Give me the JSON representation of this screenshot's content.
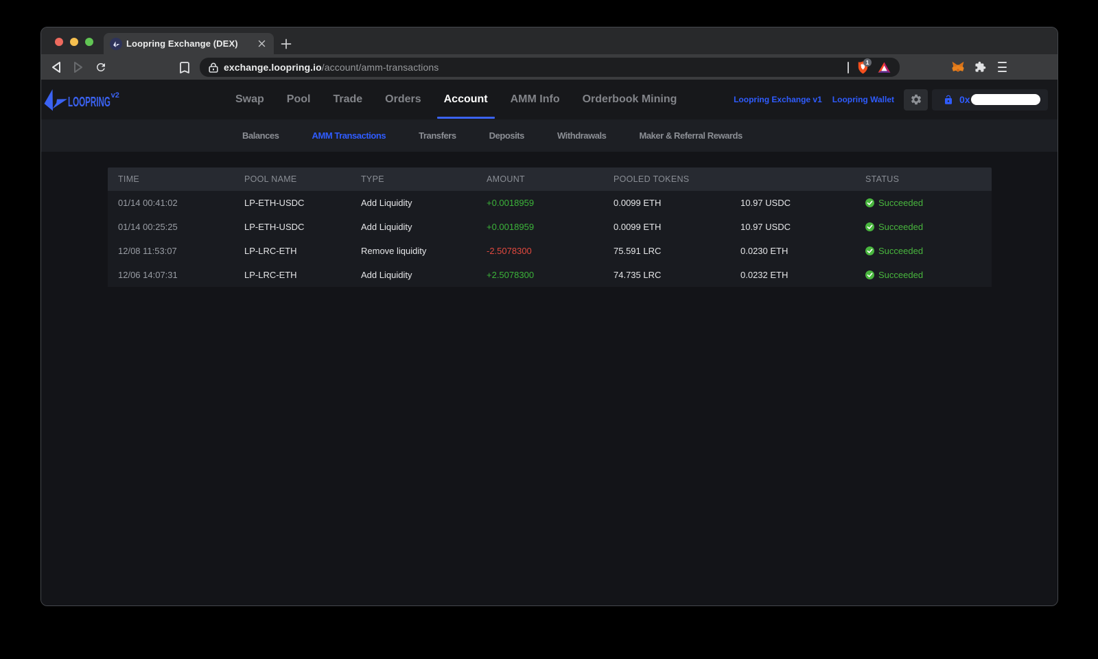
{
  "browser": {
    "tab_title": "Loopring Exchange (DEX)",
    "url_domain": "exchange.loopring.io",
    "url_path": "/account/amm-transactions",
    "shield_badge": "1"
  },
  "header": {
    "brand": "LOOPRING",
    "version": "v2",
    "nav": [
      {
        "label": "Swap"
      },
      {
        "label": "Pool"
      },
      {
        "label": "Trade"
      },
      {
        "label": "Orders"
      },
      {
        "label": "Account",
        "active": true
      },
      {
        "label": "AMM Info"
      },
      {
        "label": "Orderbook Mining"
      }
    ],
    "links": [
      {
        "label": "Loopring Exchange v1"
      },
      {
        "label": "Loopring Wallet"
      }
    ],
    "wallet": {
      "prefix": "0x"
    }
  },
  "subnav": {
    "items": [
      {
        "label": "Balances"
      },
      {
        "label": "AMM Transactions",
        "active": true
      },
      {
        "label": "Transfers"
      },
      {
        "label": "Deposits"
      },
      {
        "label": "Withdrawals"
      },
      {
        "label": "Maker & Referral Rewards"
      }
    ]
  },
  "table": {
    "columns": [
      "TIME",
      "POOL NAME",
      "TYPE",
      "AMOUNT",
      "POOLED TOKENS",
      "STATUS"
    ],
    "rows": [
      {
        "time": "01/14 00:41:02",
        "pool": "LP-ETH-USDC",
        "type": "Add Liquidity",
        "amount": "+0.0018959",
        "token_a": "0.0099 ETH",
        "token_b": "10.97 USDC",
        "status": "Succeeded"
      },
      {
        "time": "01/14 00:25:25",
        "pool": "LP-ETH-USDC",
        "type": "Add Liquidity",
        "amount": "+0.0018959",
        "token_a": "0.0099 ETH",
        "token_b": "10.97 USDC",
        "status": "Succeeded"
      },
      {
        "time": "12/08 11:53:07",
        "pool": "LP-LRC-ETH",
        "type": "Remove liquidity",
        "amount": "-2.5078300",
        "token_a": "75.591 LRC",
        "token_b": "0.0230 ETH",
        "status": "Succeeded"
      },
      {
        "time": "12/06 14:07:31",
        "pool": "LP-LRC-ETH",
        "type": "Add Liquidity",
        "amount": "+2.5078300",
        "token_a": "74.735 LRC",
        "token_b": "0.0232 ETH",
        "status": "Succeeded"
      }
    ]
  },
  "colors": {
    "brand_blue": "#3b63f3",
    "link_blue": "#2f5cff",
    "success_green": "#49b63e",
    "negative_red": "#e2493f",
    "positive_green": "#3cb43a"
  }
}
